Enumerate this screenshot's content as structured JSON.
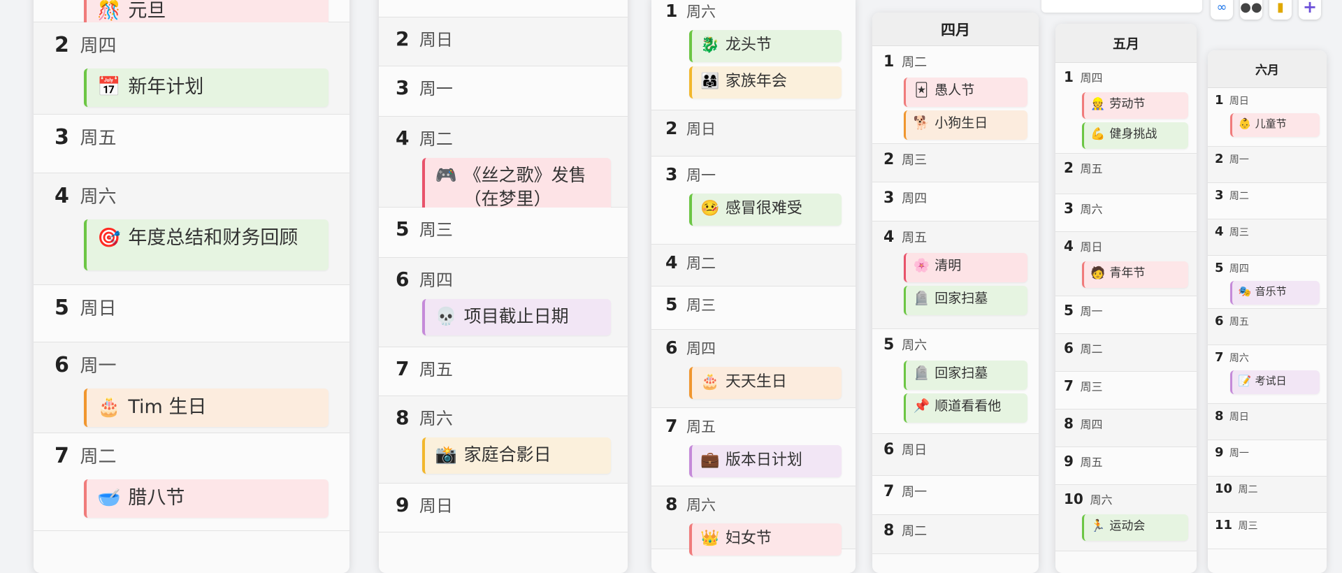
{
  "toolbar": {
    "buttons": [
      {
        "name": "link-icon",
        "glyph": "∞"
      },
      {
        "name": "eyes-icon",
        "glyph": "●●"
      },
      {
        "name": "note-icon",
        "glyph": "▮"
      },
      {
        "name": "add-icon",
        "glyph": "+"
      }
    ]
  },
  "colors": {
    "red": "#f07b7b",
    "redbg": "#fde6e8",
    "green": "#6cc644",
    "greenbg": "#e6f4e1",
    "orange": "#f0962e",
    "orangebg": "#fcecde",
    "purple": "#c58ad9",
    "purplebg": "#f2e6f5",
    "yellow": "#f2b72c",
    "yellowbg": "#fbf0dc",
    "pink": "#e8526a",
    "pinkbg": "#fde3e6"
  },
  "columns": [
    {
      "id": "jan",
      "month": "",
      "days": [
        {
          "num": "",
          "wd": "",
          "events": [
            {
              "icon": "🎊",
              "text": "元旦",
              "color": "red"
            }
          ]
        },
        {
          "num": "2",
          "wd": "周四",
          "events": [
            {
              "icon": "📅",
              "text": "新年计划",
              "color": "green"
            }
          ]
        },
        {
          "num": "3",
          "wd": "周五",
          "events": []
        },
        {
          "num": "4",
          "wd": "周六",
          "events": [
            {
              "icon": "🎯",
              "text": "年度总结和财务回顾",
              "color": "green"
            }
          ]
        },
        {
          "num": "5",
          "wd": "周日",
          "events": []
        },
        {
          "num": "6",
          "wd": "周一",
          "events": [
            {
              "icon": "🎂",
              "text": "Tim 生日",
              "color": "orange"
            }
          ]
        },
        {
          "num": "7",
          "wd": "周二",
          "events": [
            {
              "icon": "🥣",
              "text": "腊八节",
              "color": "red"
            }
          ]
        }
      ]
    },
    {
      "id": "feb",
      "month": "",
      "days": [
        {
          "num": "",
          "wd": "",
          "events": []
        },
        {
          "num": "2",
          "wd": "周日",
          "events": []
        },
        {
          "num": "3",
          "wd": "周一",
          "events": []
        },
        {
          "num": "4",
          "wd": "周二",
          "events": [
            {
              "icon": "🎮",
              "text": "《丝之歌》发售（在梦里）",
              "color": "pink"
            }
          ]
        },
        {
          "num": "5",
          "wd": "周三",
          "events": []
        },
        {
          "num": "6",
          "wd": "周四",
          "events": [
            {
              "icon": "💀",
              "text": "项目截止日期",
              "color": "purple"
            }
          ]
        },
        {
          "num": "7",
          "wd": "周五",
          "events": []
        },
        {
          "num": "8",
          "wd": "周六",
          "events": [
            {
              "icon": "📸",
              "text": "家庭合影日",
              "color": "yellow"
            }
          ]
        },
        {
          "num": "9",
          "wd": "周日",
          "events": []
        }
      ]
    },
    {
      "id": "mar",
      "month": "",
      "days": [
        {
          "num": "1",
          "wd": "周六",
          "events": [
            {
              "icon": "🐉",
              "text": "龙头节",
              "color": "green"
            },
            {
              "icon": "👨‍👩‍👧",
              "text": "家族年会",
              "color": "yellow"
            }
          ]
        },
        {
          "num": "2",
          "wd": "周日",
          "events": []
        },
        {
          "num": "3",
          "wd": "周一",
          "events": [
            {
              "icon": "🤒",
              "text": "感冒很难受",
              "color": "green"
            }
          ]
        },
        {
          "num": "4",
          "wd": "周二",
          "events": []
        },
        {
          "num": "5",
          "wd": "周三",
          "events": []
        },
        {
          "num": "6",
          "wd": "周四",
          "events": [
            {
              "icon": "🎂",
              "text": "天天生日",
              "color": "orange"
            }
          ]
        },
        {
          "num": "7",
          "wd": "周五",
          "events": [
            {
              "icon": "💼",
              "text": "版本日计划",
              "color": "purple"
            }
          ]
        },
        {
          "num": "8",
          "wd": "周六",
          "events": [
            {
              "icon": "👑",
              "text": "妇女节",
              "color": "red"
            }
          ]
        }
      ]
    },
    {
      "id": "apr",
      "month": "四月",
      "days": [
        {
          "num": "1",
          "wd": "周二",
          "events": [
            {
              "icon": "🃏",
              "text": "愚人节",
              "color": "red"
            },
            {
              "icon": "🐕",
              "text": "小狗生日",
              "color": "orange"
            }
          ]
        },
        {
          "num": "2",
          "wd": "周三",
          "events": []
        },
        {
          "num": "3",
          "wd": "周四",
          "events": []
        },
        {
          "num": "4",
          "wd": "周五",
          "events": [
            {
              "icon": "🌸",
              "text": "清明",
              "color": "pink"
            },
            {
              "icon": "🪦",
              "text": "回家扫墓",
              "color": "green"
            }
          ]
        },
        {
          "num": "5",
          "wd": "周六",
          "events": [
            {
              "icon": "🪦",
              "text": "回家扫墓",
              "color": "green"
            },
            {
              "icon": "📌",
              "text": "顺道看看他",
              "color": "green"
            }
          ]
        },
        {
          "num": "6",
          "wd": "周日",
          "events": []
        },
        {
          "num": "7",
          "wd": "周一",
          "events": []
        },
        {
          "num": "8",
          "wd": "周二",
          "events": []
        }
      ]
    },
    {
      "id": "may",
      "month": "五月",
      "days": [
        {
          "num": "1",
          "wd": "周四",
          "events": [
            {
              "icon": "👷",
              "text": "劳动节",
              "color": "red"
            },
            {
              "icon": "💪",
              "text": "健身挑战",
              "color": "green"
            }
          ]
        },
        {
          "num": "2",
          "wd": "周五",
          "events": []
        },
        {
          "num": "3",
          "wd": "周六",
          "events": []
        },
        {
          "num": "4",
          "wd": "周日",
          "events": [
            {
              "icon": "🧑",
              "text": "青年节",
              "color": "red"
            }
          ]
        },
        {
          "num": "5",
          "wd": "周一",
          "events": []
        },
        {
          "num": "6",
          "wd": "周二",
          "events": []
        },
        {
          "num": "7",
          "wd": "周三",
          "events": []
        },
        {
          "num": "8",
          "wd": "周四",
          "events": []
        },
        {
          "num": "9",
          "wd": "周五",
          "events": []
        },
        {
          "num": "10",
          "wd": "周六",
          "events": [
            {
              "icon": "🏃",
              "text": "运动会",
              "color": "green"
            }
          ]
        }
      ]
    },
    {
      "id": "jun",
      "month": "六月",
      "days": [
        {
          "num": "1",
          "wd": "周日",
          "events": [
            {
              "icon": "👶",
              "text": "儿童节",
              "color": "red"
            }
          ]
        },
        {
          "num": "2",
          "wd": "周一",
          "events": []
        },
        {
          "num": "3",
          "wd": "周二",
          "events": []
        },
        {
          "num": "4",
          "wd": "周三",
          "events": []
        },
        {
          "num": "5",
          "wd": "周四",
          "events": [
            {
              "icon": "🎭",
              "text": "音乐节",
              "color": "purple"
            }
          ]
        },
        {
          "num": "6",
          "wd": "周五",
          "events": []
        },
        {
          "num": "7",
          "wd": "周六",
          "events": [
            {
              "icon": "📝",
              "text": "考试日",
              "color": "purple"
            }
          ]
        },
        {
          "num": "8",
          "wd": "周日",
          "events": []
        },
        {
          "num": "9",
          "wd": "周一",
          "events": []
        },
        {
          "num": "10",
          "wd": "周二",
          "events": []
        },
        {
          "num": "11",
          "wd": "周三",
          "events": []
        }
      ]
    }
  ]
}
